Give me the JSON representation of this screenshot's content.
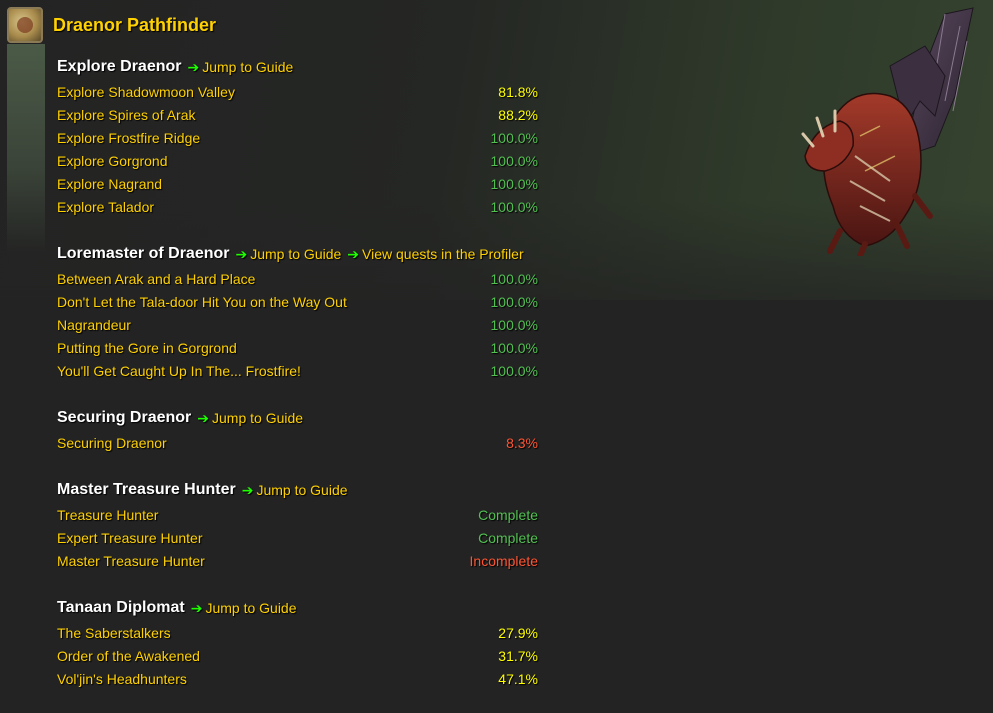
{
  "header": {
    "title": "Draenor Pathfinder",
    "icon": "achievement-icon"
  },
  "colors": {
    "name_gold": "#ffd100",
    "complete_green": "#1eff00",
    "green_percent": "#52c152",
    "partial_yellow": "#ffff00",
    "incomplete_red": "#ff5533"
  },
  "sections": [
    {
      "title": "Explore Draenor",
      "links": [
        "Jump to Guide"
      ],
      "rows": [
        {
          "name": "Explore Shadowmoon Valley",
          "value": "81.8%",
          "status": "partial"
        },
        {
          "name": "Explore Spires of Arak",
          "value": "88.2%",
          "status": "partial"
        },
        {
          "name": "Explore Frostfire Ridge",
          "value": "100.0%",
          "status": "done"
        },
        {
          "name": "Explore Gorgrond",
          "value": "100.0%",
          "status": "done"
        },
        {
          "name": "Explore Nagrand",
          "value": "100.0%",
          "status": "done"
        },
        {
          "name": "Explore Talador",
          "value": "100.0%",
          "status": "done"
        }
      ]
    },
    {
      "title": "Loremaster of Draenor",
      "links": [
        "Jump to Guide",
        "View quests in the Profiler"
      ],
      "rows": [
        {
          "name": "Between Arak and a Hard Place",
          "value": "100.0%",
          "status": "done"
        },
        {
          "name": "Don't Let the Tala-door Hit You on the Way Out",
          "value": "100.0%",
          "status": "done"
        },
        {
          "name": "Nagrandeur",
          "value": "100.0%",
          "status": "done"
        },
        {
          "name": "Putting the Gore in Gorgrond",
          "value": "100.0%",
          "status": "done"
        },
        {
          "name": "You'll Get Caught Up In The... Frostfire!",
          "value": "100.0%",
          "status": "done"
        }
      ]
    },
    {
      "title": "Securing Draenor",
      "links": [
        "Jump to Guide"
      ],
      "rows": [
        {
          "name": "Securing Draenor",
          "value": "8.3%",
          "status": "low"
        }
      ]
    },
    {
      "title": "Master Treasure Hunter",
      "links": [
        "Jump to Guide"
      ],
      "rows": [
        {
          "name": "Treasure Hunter",
          "value": "Complete",
          "status": "done"
        },
        {
          "name": "Expert Treasure Hunter",
          "value": "Complete",
          "status": "done"
        },
        {
          "name": "Master Treasure Hunter",
          "value": "Incomplete",
          "status": "low"
        }
      ]
    },
    {
      "title": "Tanaan Diplomat",
      "links": [
        "Jump to Guide"
      ],
      "rows": [
        {
          "name": "The Saberstalkers",
          "value": "27.9%",
          "status": "partial"
        },
        {
          "name": "Order of the Awakened",
          "value": "31.7%",
          "status": "partial"
        },
        {
          "name": "Vol'jin's Headhunters",
          "value": "47.1%",
          "status": "partial"
        }
      ]
    }
  ],
  "mount_image": "mount-preview-image"
}
